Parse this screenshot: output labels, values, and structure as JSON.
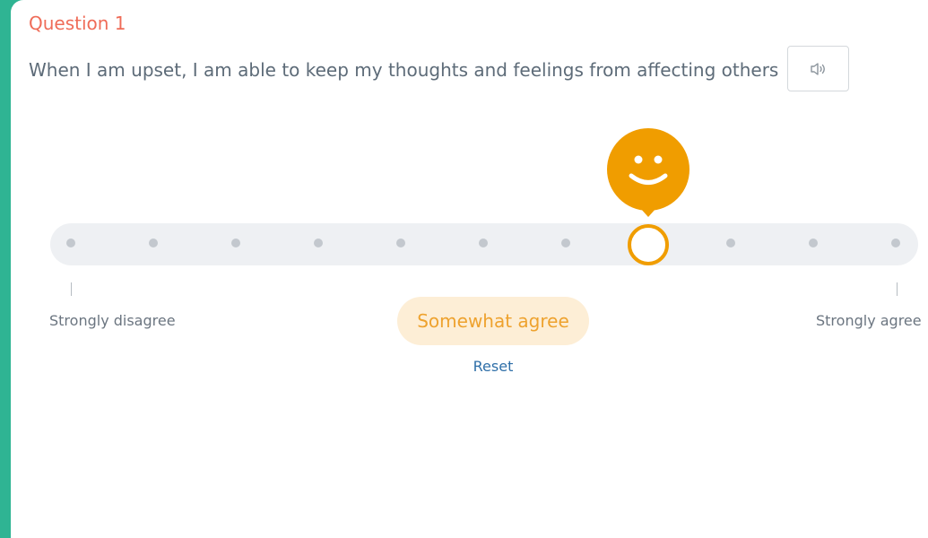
{
  "question": {
    "number_label": "Question 1",
    "text": "When I am upset, I am able to keep my thoughts and feelings from affecting others",
    "audio_icon": "speaker-icon"
  },
  "scale": {
    "points": 11,
    "selected_index": 7,
    "min_label": "Strongly disagree",
    "max_label": "Strongly agree",
    "selected_label": "Somewhat agree",
    "reset_label": "Reset",
    "bubble_icon": "smiley-face-icon",
    "accent_color": "#f09d00"
  }
}
